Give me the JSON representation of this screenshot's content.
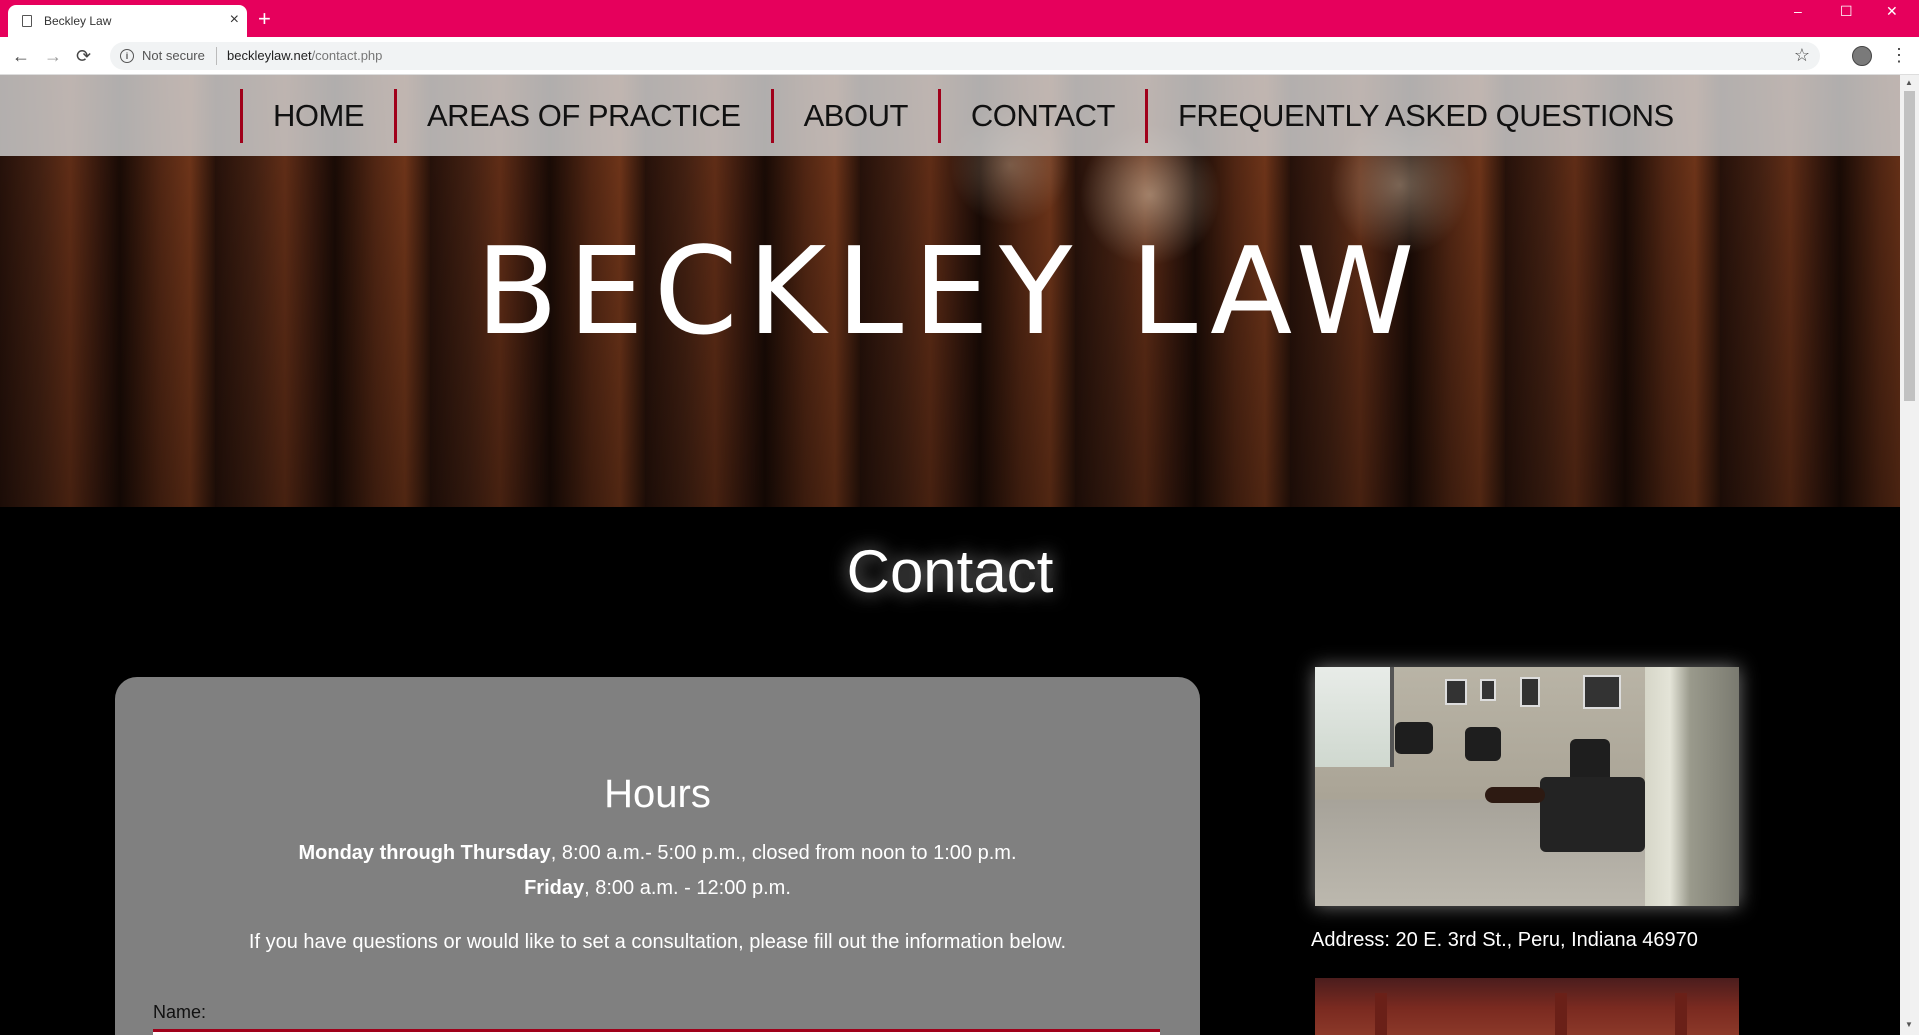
{
  "browser": {
    "tab_title": "Beckley Law",
    "tab_close": "×",
    "new_tab": "+",
    "window_controls": {
      "minimize": "–",
      "maximize": "☐",
      "close": "✕"
    },
    "back": "←",
    "forward": "→",
    "reload": "⟳",
    "info": "i",
    "security_label": "Not secure",
    "url_host": "beckleylaw.net",
    "url_path": "/contact.php",
    "star": "☆",
    "menu": "⋮"
  },
  "nav": {
    "items": [
      {
        "label": "HOME"
      },
      {
        "label": "AREAS OF PRACTICE"
      },
      {
        "label": "ABOUT"
      },
      {
        "label": "CONTACT"
      },
      {
        "label": "FREQUENTLY ASKED QUESTIONS"
      }
    ],
    "divider_color": "#a0001a"
  },
  "hero": {
    "title": "BECKLEY LAW"
  },
  "page": {
    "heading": "Contact"
  },
  "hours": {
    "title": "Hours",
    "weekday_days": "Monday through Thursday",
    "weekday_times": ", 8:00 a.m.- 5:00 p.m., closed from noon to 1:00 p.m.",
    "friday_day": "Friday",
    "friday_times": ", 8:00 a.m. - 12:00 p.m.",
    "intro": "If you have questions or would like to set a consultation, please fill out the information below."
  },
  "form": {
    "name_label": "Name:",
    "name_value": ""
  },
  "sidebar": {
    "address": "Address: 20 E. 3rd St., Peru, Indiana 46970"
  },
  "colors": {
    "tab_bar": "#e6005c",
    "accent": "#a0001a",
    "card": "#808080"
  }
}
